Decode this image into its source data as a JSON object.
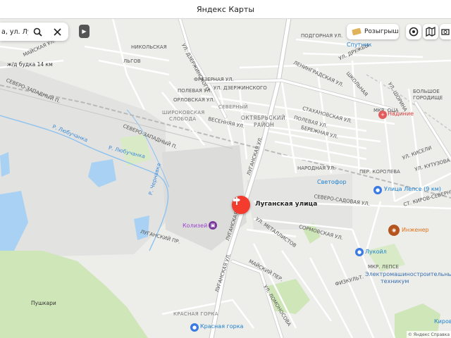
{
  "window": {
    "title": "Яндекс Карты"
  },
  "search": {
    "value": "а, ул. Луга",
    "search_label": "Search",
    "clear_label": "Clear"
  },
  "toolbar": {
    "promo_label": "Розыгрыш"
  },
  "pin": {
    "label": "Луганская улица"
  },
  "labels": {
    "podgornaya": "ПОДГОРНАЯ УЛ.",
    "sputnik": "Спутник",
    "nikolskaya": "НИКОЛЬСКАЯ",
    "lgov": "ЛЬГОВ",
    "mayskaya": "МАЙСКАЯ УЛ.",
    "budka": "ж/д будка 14 км",
    "dzerzhinsky_st": "УЛ. ДЗЕРЖИНСКОГО",
    "dzerzhinsky_v": "УЛ. ДЗЕРЖИНСКОГО",
    "leningradskaya": "ЛЕНИНГРАДСКАЯ УЛ.",
    "shkolnaya": "ШКОЛЬНАЯ",
    "frezernaya": "ФРЕЗЕРНАЯ УЛ.",
    "polevaya": "ПОЛЕВАЯ УЛ.",
    "orlovskaya": "ОРЛОВСКАЯ УЛ.",
    "northwest_road": "СЕВЕРО-ЗАПАДНЫЙ П.",
    "severny": "СЕВЕРНЫЙ",
    "oktyabrsky1": "ОКТЯБРЬСКИЙ",
    "oktyabrsky2": "РАЙОН",
    "stakhanov": "СТАХАНОВСКАЯ УЛ.",
    "poleva2": "ПОЛЕВАЯ УЛ.",
    "berezhnoy": "БЕРЕЖНАЯ УЛ.",
    "mkr": "МКР. ОЦА",
    "nadezhda": "Надиние",
    "shirokovskaya": "ШИРОКОВСКАЯ",
    "sloboda": "СЛОБОДА",
    "vesennyaya": "ВЕСЕННЯЯ УЛ.",
    "stream1": "Р. Любучанка",
    "stream2": "Р. Любучанка",
    "northwest2": "СЕВЕРО-ЗАПАДНЫЙ П.",
    "luganskaya_v": "ЛУГАНСКАЯ УЛ.",
    "narodnaya": "НАРОДНАЯ УЛ.",
    "svetofor": "Светофор",
    "lepse": "Улица Лепсе (9 км)",
    "north_sad": "СЕВЕРО-САДОВАЯ УЛ.",
    "kiseli": "УЛ. КИСЕЛИ",
    "kirovskaya": "СТ. КИРОВ-СЕВЕРНЫЙ",
    "zarechnaya": "Р. Чернавка",
    "koliseum": "Колизей",
    "luganskaya_v2": "ЛУГАНСКАЯ УЛ.",
    "luganskaya_v3": "ЛУГАНСКИЙ ПР.",
    "metallistov": "УЛ. МЕТАЛЛИСТОВ",
    "sormovskaya": "СОРМОВСКАЯ УЛ.",
    "inzhener": "Инженер",
    "lukoil": "Лукойл",
    "maysky": "МАЙСКИЙ ПЕР.",
    "mkr2": "МКР. ЛЕПСЕ",
    "electro": "Электромашиностроительный",
    "technikum": "техникум",
    "luganskaya_v4": "ЛУГАНСКАЯ УЛ.",
    "lomonosova": "УЛ. ЛОМОНОСОВА",
    "fizkultury": "ФИЗКУЛЬТ.",
    "pushkari": "Пушкари",
    "krasnaya_gorka": "КРАСНАЯ ГОРКА",
    "krasnaya_gorka_poi": "Красная горка",
    "kirov": "Киров",
    "bolshoe": "БОЛЬШОЕ",
    "gorodische": "ГОРОДИЩЕ",
    "kutuzova": "УЛ. КУТУЗОВА",
    "shorina": "УЛ. ШОРИНА",
    "druzhby": "УЛ. ДРУЖБЫ",
    "korolev": "ПЕР. КОРОЛЕВА"
  },
  "copyright": "© Яндекс  Справка",
  "colors": {
    "pin": "#f33b2e",
    "water": "#a9d1f3",
    "park": "#cfe6b8",
    "road": "#ffffff",
    "road_major": "#d9d9d9"
  }
}
